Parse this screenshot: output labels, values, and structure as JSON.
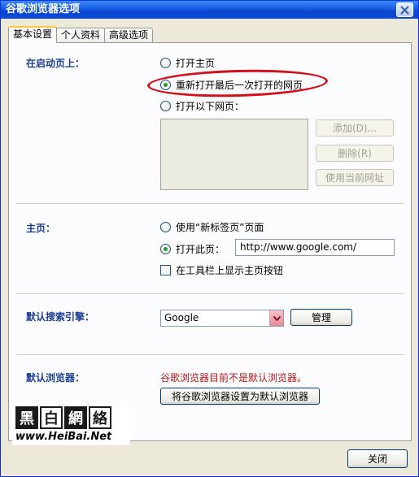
{
  "window": {
    "title": "谷歌浏览器选项"
  },
  "tabs": [
    {
      "label": "基本设置",
      "active": true
    },
    {
      "label": "个人资料",
      "active": false
    },
    {
      "label": "高级选项",
      "active": false
    }
  ],
  "startup": {
    "label": "在启动页上：",
    "options": [
      {
        "label": "打开主页",
        "selected": false
      },
      {
        "label": "重新打开最后一次打开的网页",
        "selected": true
      },
      {
        "label": "打开以下网页：",
        "selected": false
      }
    ],
    "buttons": {
      "add": "添加(D)...",
      "remove": "删除(R)",
      "use_current": "使用当前网址"
    }
  },
  "homepage": {
    "label": "主页：",
    "option_new_tab": "使用“新标签页”页面",
    "option_open_page": "打开此页：",
    "url_value": "http://www.google.com/",
    "show_home_button": "在工具栏上显示主页按钮"
  },
  "search": {
    "label": "默认搜索引擎：",
    "selected": "Google",
    "manage_button": "管理"
  },
  "default_browser": {
    "label": "默认浏览器：",
    "status": "谷歌浏览器目前不是默认浏览器。",
    "set_default_button": "将谷歌浏览器设置为默认浏览器"
  },
  "watermark": {
    "chars": [
      "黑",
      "白",
      "網",
      "絡"
    ],
    "url": "www.HeiBai.Net"
  },
  "footer": {
    "close_button": "关闭"
  },
  "colors": {
    "section_label": "#1c3f94",
    "status_red": "#b31919",
    "highlight": "#d4101a"
  }
}
